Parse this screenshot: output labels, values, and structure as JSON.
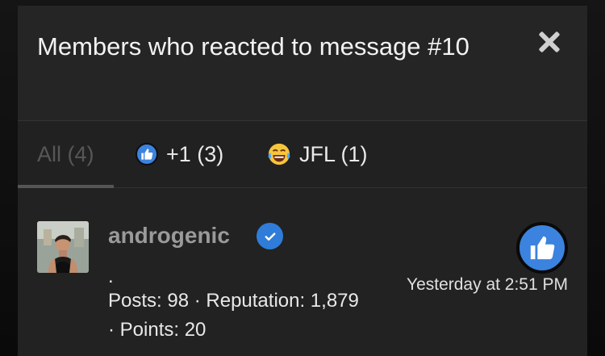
{
  "modal": {
    "title": "Members who reacted to message #10"
  },
  "tabs": [
    {
      "label": "All (4)",
      "icon": null,
      "active": true
    },
    {
      "label": "+1 (3)",
      "icon": "thumbs-up-icon",
      "active": false
    },
    {
      "label": "JFL (1)",
      "icon": "crying-laughing-emoji-icon",
      "active": false
    }
  ],
  "member": {
    "username": "androgenic",
    "verified_icon": "verified-check-icon",
    "dot": ".",
    "stats_line1": "Posts: 98 · Reputation: 1,879",
    "stats_line2": "· Points: 20",
    "timestamp": "Yesterday at 2:51 PM",
    "reaction_icon": "thumbs-up-icon"
  },
  "colors": {
    "modal_bg": "#242424",
    "accent_blue": "#3b83de",
    "username": "#9a9a9a"
  }
}
